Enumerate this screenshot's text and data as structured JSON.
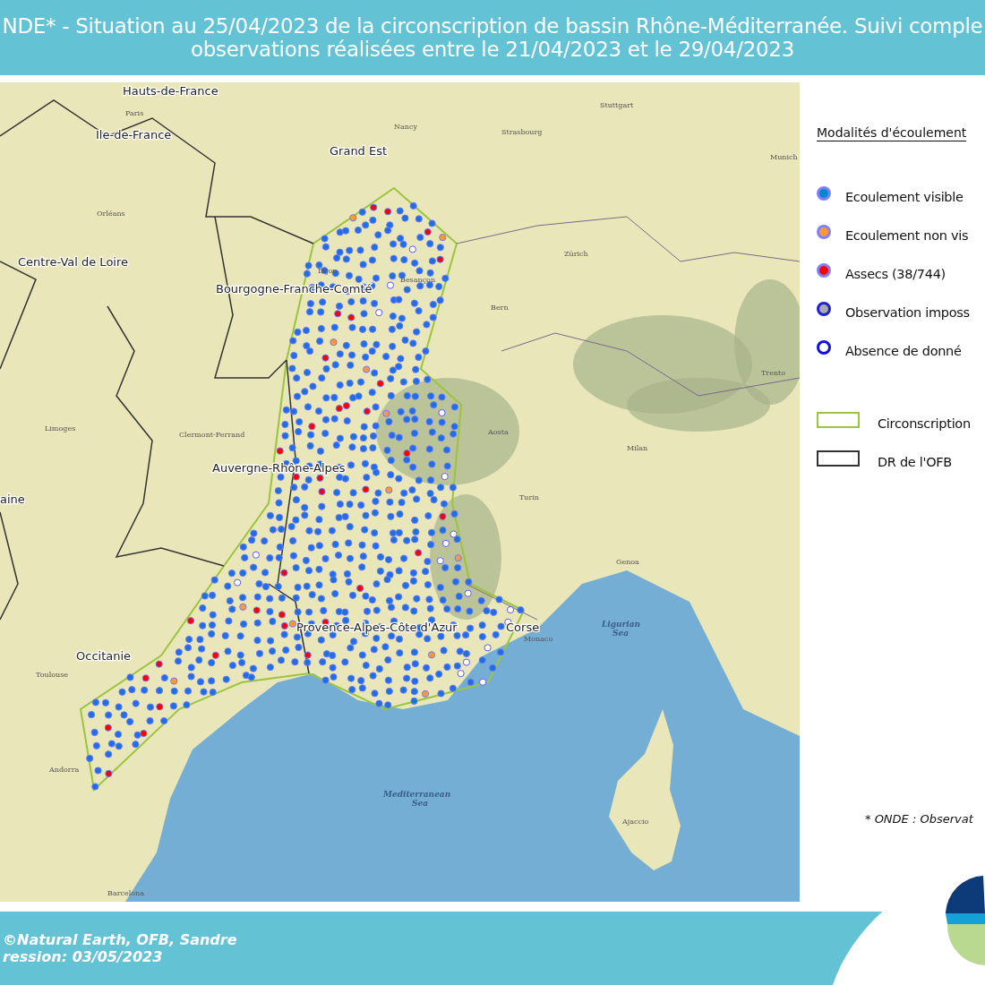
{
  "header": {
    "title_lines": [
      "NDE* - Situation au 25/04/2023 de la circonscription de bassin Rhône-Méditerranée. Suivi comple",
      "observations réalisées entre le 21/04/2023 et le 29/04/2023"
    ]
  },
  "map": {
    "labels": [
      {
        "text": "Hauts-de-France",
        "kind": "region"
      },
      {
        "text": "Paris",
        "kind": "city"
      },
      {
        "text": "Ile-de-France",
        "kind": "region"
      },
      {
        "text": "Grand Est",
        "kind": "region"
      },
      {
        "text": "Centre-Val de Loire",
        "kind": "region"
      },
      {
        "text": "Bourgogne-Franche-Comté",
        "kind": "region"
      },
      {
        "text": "Auvergne-Rhône-Alpes",
        "kind": "region"
      },
      {
        "text": "aine",
        "kind": "region"
      },
      {
        "text": "Occitanie",
        "kind": "region"
      },
      {
        "text": "Provence-Alpes-Côte d'Azur",
        "kind": "region"
      },
      {
        "text": "Corse",
        "kind": "region"
      },
      {
        "text": "Mediterranean",
        "kind": "sea"
      },
      {
        "text": "Sea",
        "kind": "sea"
      },
      {
        "text": "Ligurian",
        "kind": "sea"
      },
      {
        "text": "Sea",
        "kind": "sea"
      },
      {
        "text": "Nancy",
        "kind": "city"
      },
      {
        "text": "Strasbourg",
        "kind": "city"
      },
      {
        "text": "Stuttgart",
        "kind": "city"
      },
      {
        "text": "Munich",
        "kind": "city"
      },
      {
        "text": "Zürich",
        "kind": "city"
      },
      {
        "text": "Bern",
        "kind": "city"
      },
      {
        "text": "Orléans",
        "kind": "city"
      },
      {
        "text": "Dijon",
        "kind": "city"
      },
      {
        "text": "Besançon",
        "kind": "city"
      },
      {
        "text": "Clermont-Ferrand",
        "kind": "city"
      },
      {
        "text": "Limoges",
        "kind": "city"
      },
      {
        "text": "Aosta",
        "kind": "city"
      },
      {
        "text": "Milan",
        "kind": "city"
      },
      {
        "text": "Turin",
        "kind": "city"
      },
      {
        "text": "Trento",
        "kind": "city"
      },
      {
        "text": "Genoa",
        "kind": "city"
      },
      {
        "text": "Monaco",
        "kind": "city"
      },
      {
        "text": "Toulouse",
        "kind": "city"
      },
      {
        "text": "Ajaccio",
        "kind": "city"
      },
      {
        "text": "Andorra",
        "kind": "city"
      },
      {
        "text": "Barcelona",
        "kind": "city"
      }
    ]
  },
  "legend": {
    "title": "Modalités d'écoulement",
    "items": [
      {
        "kind": "point",
        "color": "#0088cc",
        "label": "Ecoulement visible"
      },
      {
        "kind": "point",
        "color": "#ff9933",
        "label": "Ecoulement non vis"
      },
      {
        "kind": "point",
        "color": "#ff0000",
        "label": "Assecs (38/744)"
      },
      {
        "kind": "point-dark-ring",
        "color": "#aaaaaa",
        "label": "Observation imposs"
      },
      {
        "kind": "ring",
        "color": "#1010e0",
        "label": "Absence de donné"
      },
      {
        "kind": "area",
        "color": "#9cc43c",
        "label": "Circonscription"
      },
      {
        "kind": "area",
        "color": "#333333",
        "label": "DR de l'OFB"
      }
    ],
    "footnote": "* ONDE : Observat"
  },
  "footer": {
    "lines": [
      "©Natural Earth, OFB, Sandre",
      "ression: 03/05/2023"
    ]
  }
}
